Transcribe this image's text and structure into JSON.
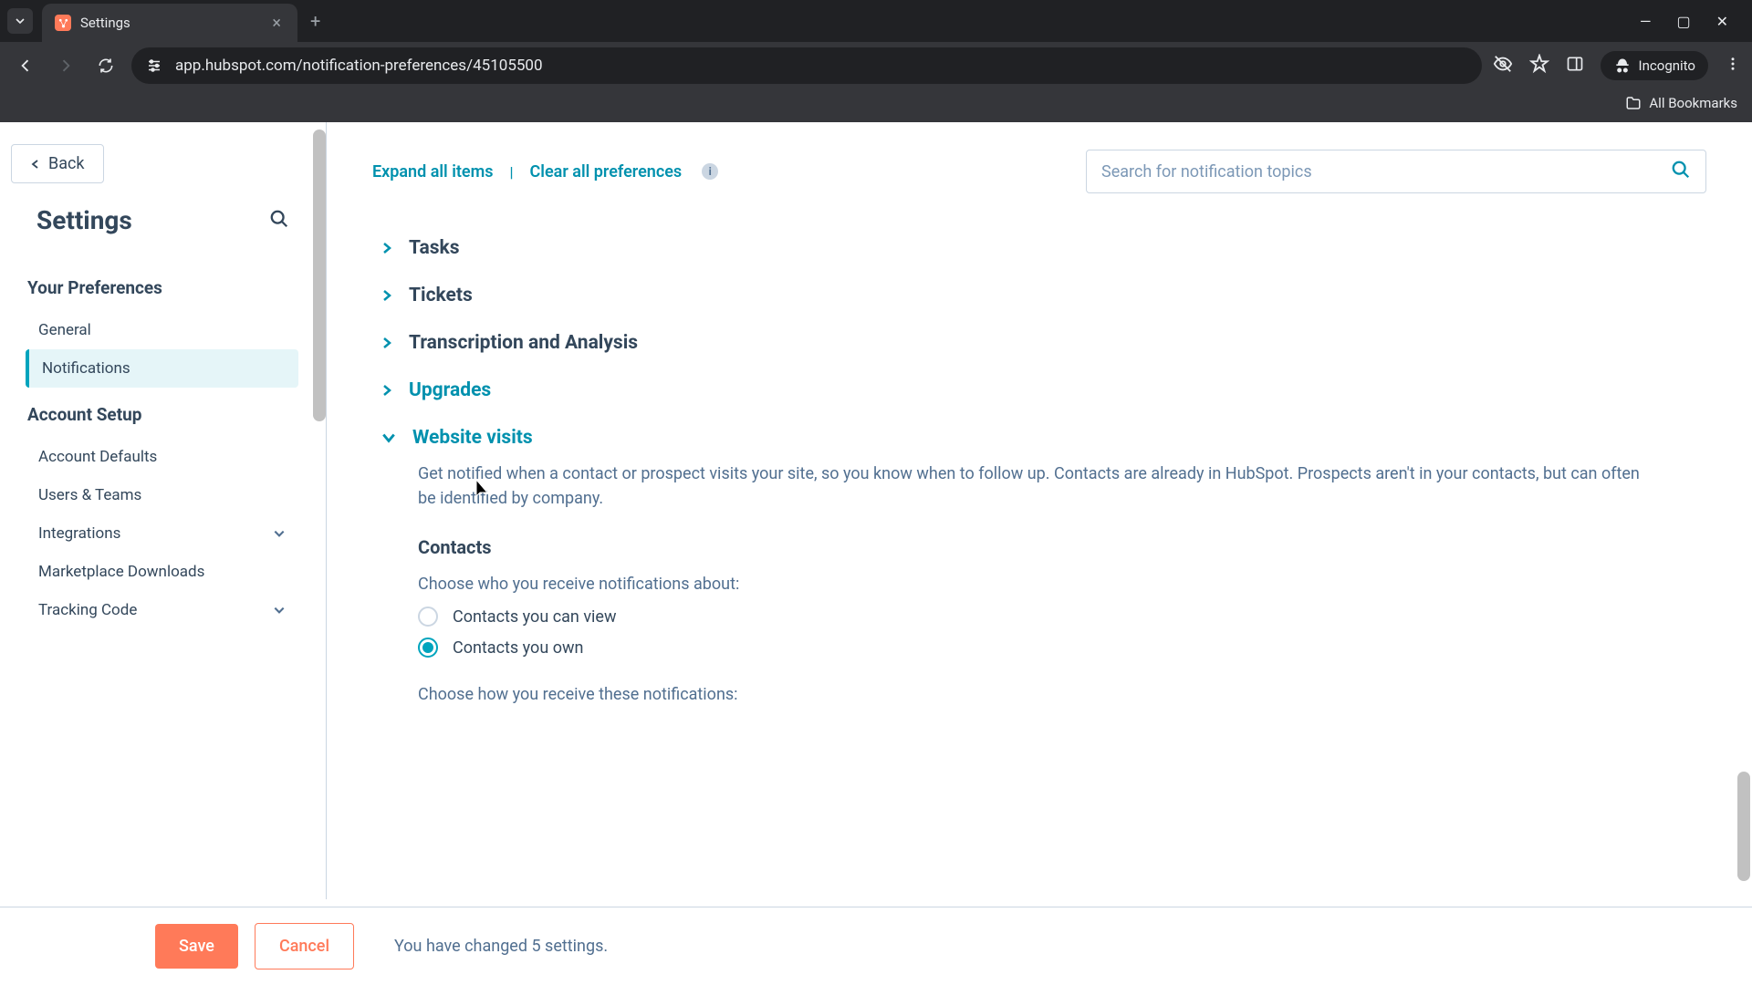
{
  "browser": {
    "tab_title": "Settings",
    "url": "app.hubspot.com/notification-preferences/45105500",
    "incognito_label": "Incognito",
    "all_bookmarks": "All Bookmarks"
  },
  "sidebar": {
    "back_label": "Back",
    "title": "Settings",
    "sections": [
      {
        "title": "Your Preferences",
        "items": [
          "General",
          "Notifications"
        ],
        "active_index": 1
      },
      {
        "title": "Account Setup",
        "items": [
          "Account Defaults",
          "Users & Teams",
          "Integrations",
          "Marketplace Downloads",
          "Tracking Code"
        ]
      }
    ]
  },
  "toolbar": {
    "expand_label": "Expand all items",
    "clear_label": "Clear all preferences",
    "search_placeholder": "Search for notification topics"
  },
  "collapsed_sections": [
    "Tasks",
    "Tickets",
    "Transcription and Analysis",
    "Upgrades"
  ],
  "expanded_section": {
    "title": "Website visits",
    "description": "Get notified when a contact or prospect visits your site, so you know when to follow up. Contacts are already in HubSpot. Prospects aren't in your contacts, but can often be identified by company.",
    "subsection_title": "Contacts",
    "who_label": "Choose who you receive notifications about:",
    "radio1": "Contacts you can view",
    "radio2": "Contacts you own",
    "how_label": "Choose how you receive these notifications:"
  },
  "footer": {
    "save": "Save",
    "cancel": "Cancel",
    "message": "You have changed 5 settings."
  }
}
